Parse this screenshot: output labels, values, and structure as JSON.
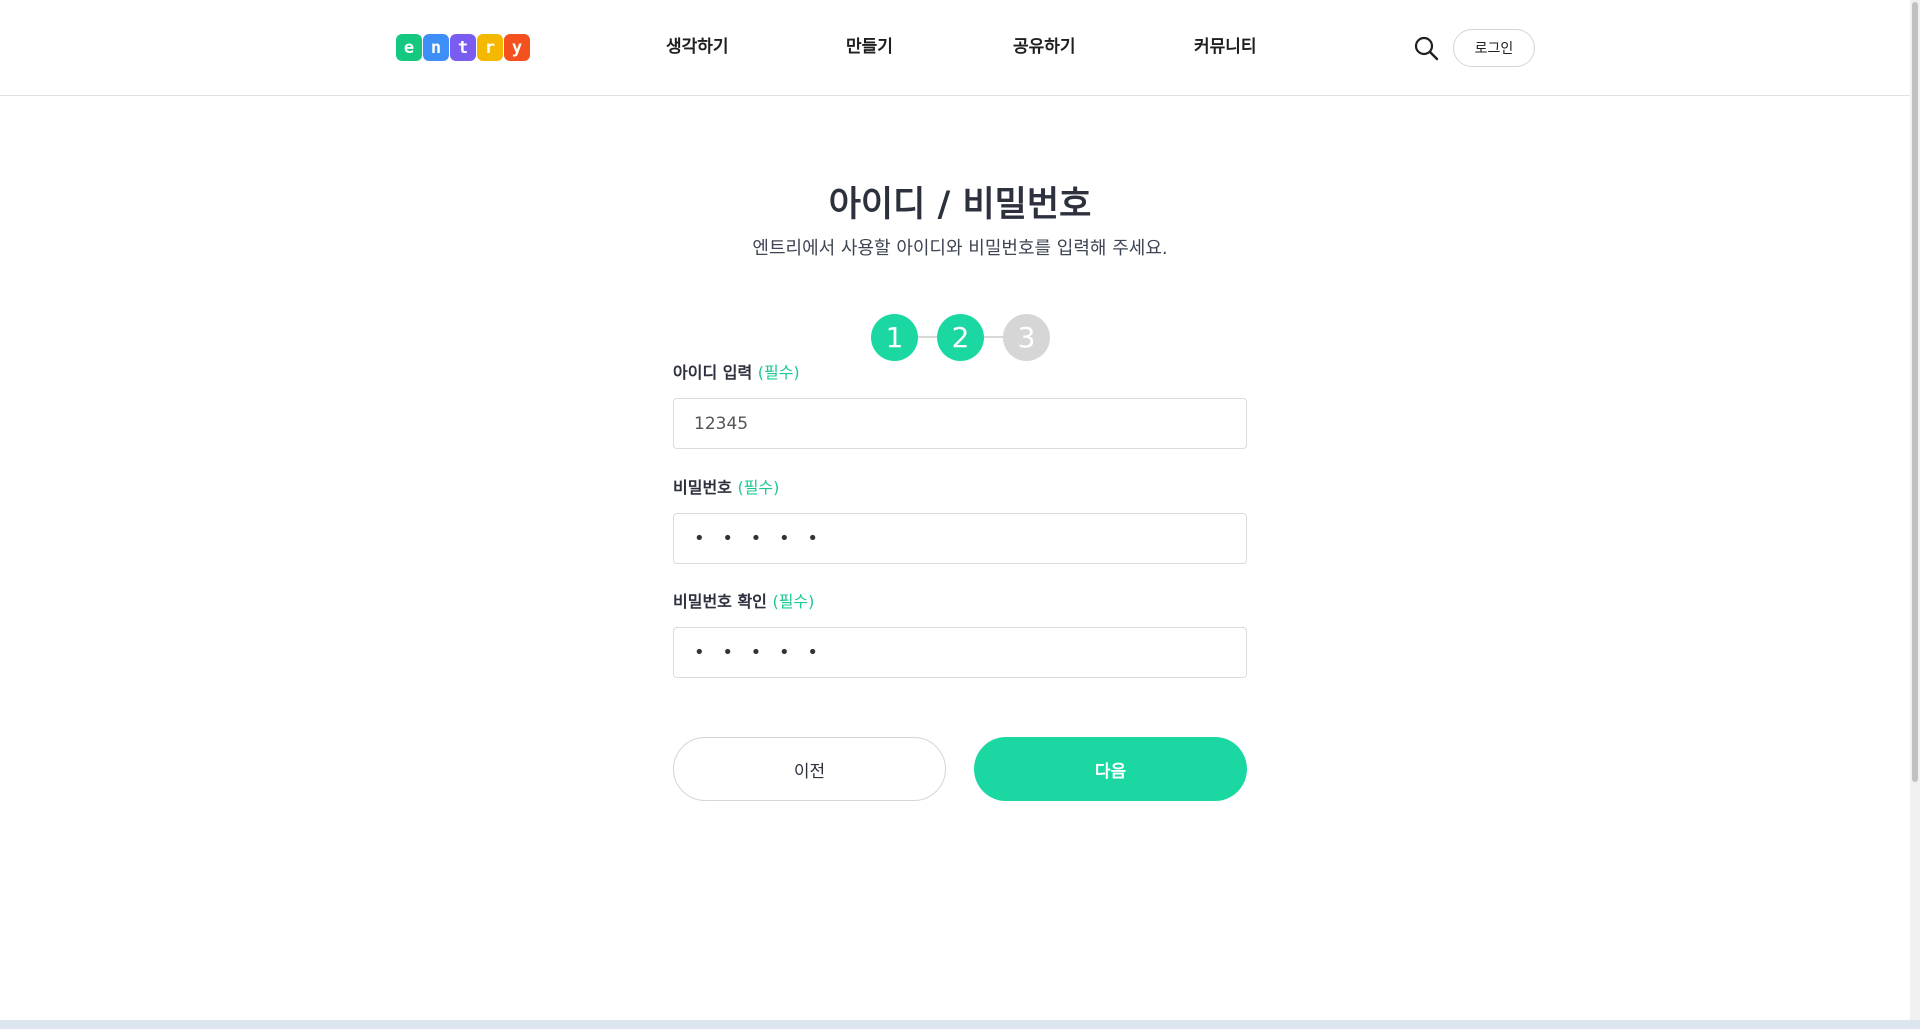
{
  "header": {
    "logo_letters": [
      "e",
      "n",
      "t",
      "r",
      "y"
    ],
    "logo_colors": [
      "#14c97f",
      "#3e8ef7",
      "#7b5cf0",
      "#f5b800",
      "#f4511e"
    ],
    "nav": [
      "생각하기",
      "만들기",
      "공유하기",
      "커뮤니티"
    ],
    "search_icon": "search-icon",
    "login_label": "로그인"
  },
  "main": {
    "title": "아이디 / 비밀번호",
    "subtitle": "엔트리에서 사용할 아이디와 비밀번호를 입력해 주세요.",
    "steps": [
      "1",
      "2",
      "3"
    ],
    "active_step": 2,
    "accent_color": "#1bd8a3",
    "inactive_step_color": "#d6d6d6"
  },
  "form": {
    "required_tag": "(필수)",
    "id_label": "아이디 입력",
    "id_value": "12345",
    "password_label": "비밀번호",
    "password_value": "• • • • •",
    "password_confirm_label": "비밀번호 확인",
    "password_confirm_value": "• • • • •"
  },
  "buttons": {
    "prev_label": "이전",
    "next_label": "다음"
  }
}
